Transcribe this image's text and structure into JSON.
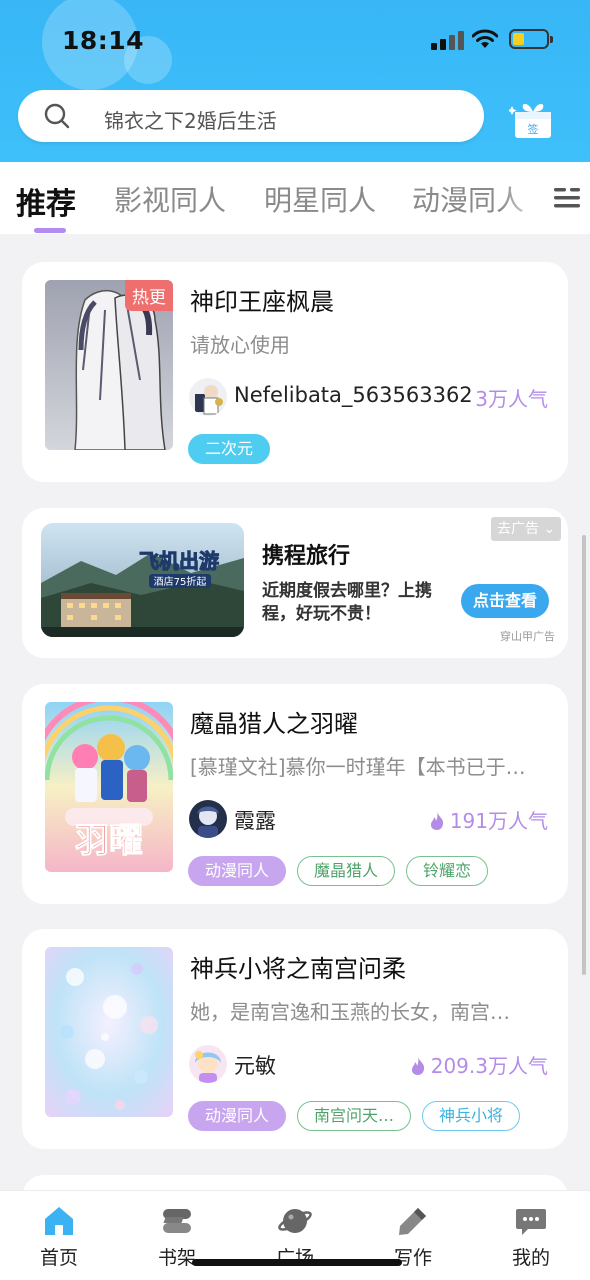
{
  "status_bar": {
    "time": "18:14"
  },
  "search": {
    "placeholder": "锦衣之下2婚后生活",
    "sign_label": "签"
  },
  "tabs": [
    {
      "label": "推荐",
      "active": true
    },
    {
      "label": "影视同人",
      "active": false
    },
    {
      "label": "明星同人",
      "active": false
    },
    {
      "label": "动漫同人",
      "active": false
    }
  ],
  "feed": [
    {
      "title": "神印王座枫晨",
      "badge": "热更",
      "description": "请放心使用",
      "author": "Nefelibata_563563362",
      "popularity": "3万人气",
      "tags": [
        "二次元"
      ]
    },
    {
      "title": "魔晶猎人之羽曜",
      "description": "[慕瑾文社]慕你一时瑾年【本书已于…",
      "author": "霞露",
      "popularity": "191万人气",
      "tags": [
        "动漫同人",
        "魔晶猎人",
        "铃耀恋"
      ],
      "cover_text": "羽曜"
    },
    {
      "title": "神兵小将之南宫问柔",
      "description": "她，是南宫逸和玉燕的长女，南宫…",
      "author": "元敏",
      "popularity": "209.3万人气",
      "tags": [
        "动漫同人",
        "南宫问天…",
        "神兵小将"
      ]
    }
  ],
  "ad": {
    "title": "携程旅行",
    "text": "近期度假去哪里？上携程，好玩不贵！",
    "button": "点击查看",
    "close_label": "去广告",
    "source": "穿山甲广告",
    "image_headline": "飞机出游",
    "image_sub": "酒店75折起"
  },
  "nav": [
    {
      "label": "首页",
      "icon": "home-icon",
      "active": true
    },
    {
      "label": "书架",
      "icon": "bookshelf-icon",
      "active": false
    },
    {
      "label": "广场",
      "icon": "planet-icon",
      "active": false
    },
    {
      "label": "写作",
      "icon": "pen-icon",
      "active": false
    },
    {
      "label": "我的",
      "icon": "chat-bubble-icon",
      "active": false
    }
  ],
  "colors": {
    "header": "#3bb8f7",
    "accent_purple": "#b28cf0",
    "popularity": "#b48ce8",
    "nav_active": "#3bb2f2"
  }
}
